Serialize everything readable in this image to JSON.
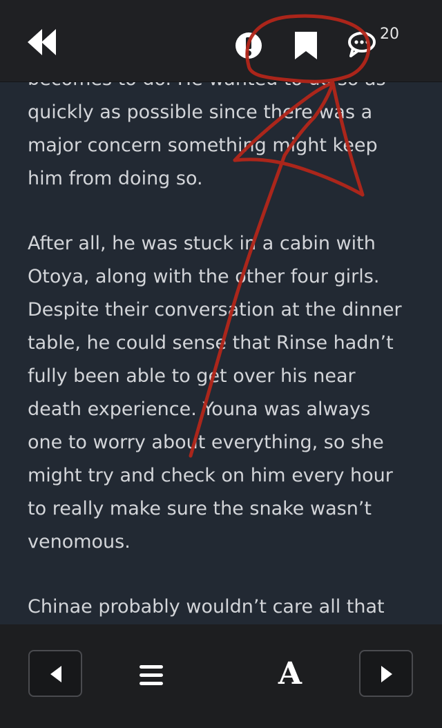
{
  "header": {
    "back_icon": "rewind-icon",
    "info_icon": "info-icon",
    "bookmark_icon": "bookmark-icon",
    "comments_icon": "comment-bubble-icon",
    "comment_count": "20"
  },
  "reader": {
    "paragraphs": [
      {
        "lines": [
          "becomes to do. He wanted to do so as",
          "quickly as possible since there was a",
          "major concern something might keep",
          "him from doing so."
        ]
      },
      {
        "lines": [
          "After all, he was stuck in a cabin with",
          "Otoya, along with the other four girls.",
          "Despite their conversation at the dinner",
          "table, he could sense that Rinse hadn’t",
          "fully been able to get over his near",
          "death experience. Youna was always",
          "one to worry about everything, so she",
          "might try and check on him every hour",
          "to really make sure the snake wasn’t",
          "venomous."
        ]
      },
      {
        "lines": [
          "Chinae probably wouldn’t care all that"
        ]
      }
    ]
  },
  "footer": {
    "prev_icon": "triangle-left-icon",
    "menu_icon": "hamburger-menu-icon",
    "font_label": "A",
    "next_icon": "triangle-right-icon"
  },
  "annotation": {
    "color": "#b3261a"
  },
  "colors": {
    "header_bg": "#1f2023",
    "reader_bg": "#222933",
    "text": "#d3d5d9",
    "footer_bg": "#1d1e20"
  }
}
